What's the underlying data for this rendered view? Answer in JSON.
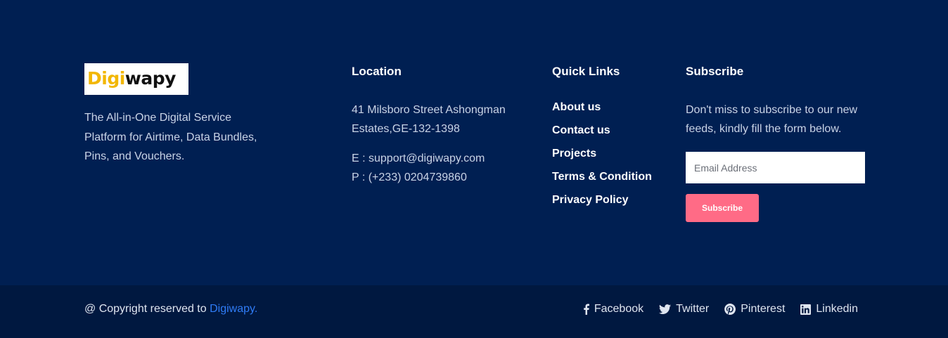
{
  "brand": {
    "logo_part1": "Digi",
    "logo_part2": "wapy",
    "description": "The All-in-One Digital Service Platform for Airtime, Data Bundles, Pins, and Vouchers."
  },
  "location": {
    "heading": "Location",
    "address": "41 Milsboro Street Ashongman Estates,GE-132-1398",
    "email": "E : support@digiwapy.com",
    "phone": "P : (+233) 0204739860"
  },
  "quick_links": {
    "heading": "Quick Links",
    "items": [
      "About us",
      "Contact us",
      "Projects",
      "Terms & Condition",
      "Privacy Policy"
    ]
  },
  "subscribe": {
    "heading": "Subscribe",
    "text": "Don't miss to subscribe to our new feeds, kindly fill the form below.",
    "email_placeholder": "Email Address",
    "button_label": "Subscribe"
  },
  "bottom": {
    "copyright_prefix": "@ Copyright reserved to ",
    "copyright_link": "Digiwapy.",
    "social": [
      {
        "label": "Facebook",
        "icon": "facebook-icon"
      },
      {
        "label": "Twitter",
        "icon": "twitter-icon"
      },
      {
        "label": "Pinterest",
        "icon": "pinterest-icon"
      },
      {
        "label": "Linkedin",
        "icon": "linkedin-icon"
      }
    ]
  },
  "colors": {
    "background": "#001f52",
    "bottom_bar": "#001840",
    "accent_button": "#ff6b86",
    "link_blue": "#2f7cf6",
    "logo_yellow": "#f2b705"
  }
}
